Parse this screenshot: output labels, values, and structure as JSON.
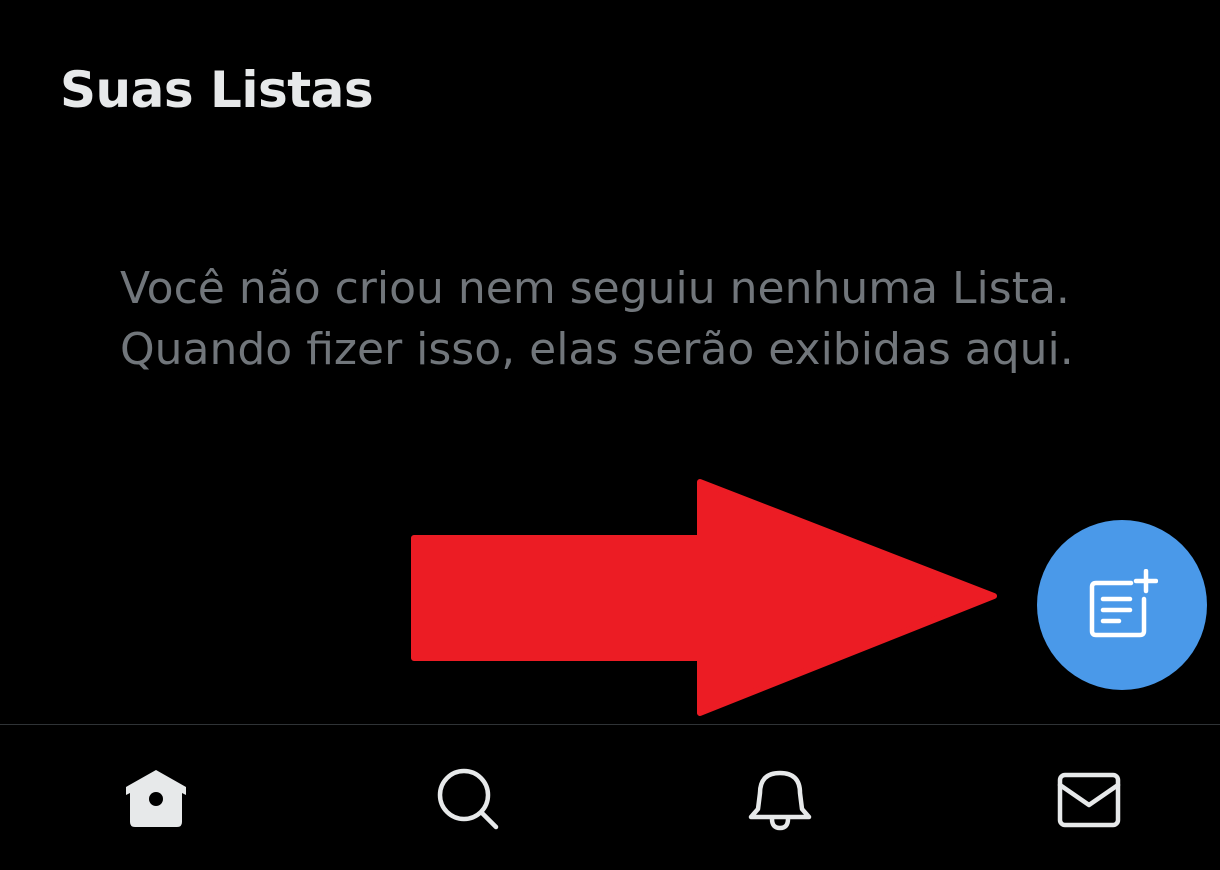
{
  "header": {
    "title": "Suas Listas"
  },
  "empty_state": {
    "line1": "Você não criou nem seguiu nenhuma Lista.",
    "line2": "Quando fizer isso, elas serão exibidas aqui."
  },
  "fab": {
    "icon": "new-list-icon",
    "color": "#4a99e9"
  },
  "annotation": {
    "icon": "red-arrow",
    "color": "#ec1c24"
  },
  "bottom_nav": {
    "items": [
      {
        "icon": "home-icon",
        "active": true
      },
      {
        "icon": "search-icon",
        "active": false
      },
      {
        "icon": "bell-icon",
        "active": false
      },
      {
        "icon": "mail-icon",
        "active": false
      }
    ]
  },
  "colors": {
    "background": "#000000",
    "primary_text": "#e7e9ea",
    "secondary_text": "#71767b",
    "divider": "#2f3336"
  }
}
